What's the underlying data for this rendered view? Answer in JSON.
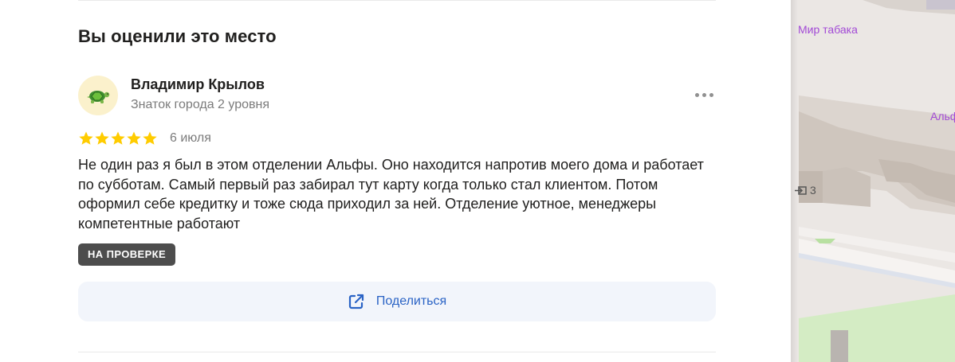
{
  "section": {
    "title": "Вы оценили это место"
  },
  "review": {
    "author_name": "Владимир Крылов",
    "author_level": "Знаток города 2 уровня",
    "avatar_icon": "turtle-icon",
    "rating": 5,
    "rating_max": 5,
    "date": "6 июля",
    "text": "Не один раз я был в этом отделении Альфы. Оно находится напротив моего дома и работает по субботам. Самый первый раз забирал тут карту когда только стал клиентом. Потом оформил себе кредитку и тоже сюда приходил за ней. Отделение уютное, менеджеры компетентные работают",
    "status": "НА ПРОВЕРКЕ",
    "more_icon": "more-dots-icon"
  },
  "share": {
    "label": "Поделиться",
    "icon": "share-external-icon"
  },
  "map": {
    "labels": {
      "tobacco": "Мир табака",
      "alfa": "Альф",
      "entrance": "3"
    }
  },
  "colors": {
    "star": "#fc0",
    "accent": "#2a63c5",
    "badge": "#4d4d4d",
    "share_bg": "#f2f5fb",
    "muted": "#7b7b7b"
  }
}
